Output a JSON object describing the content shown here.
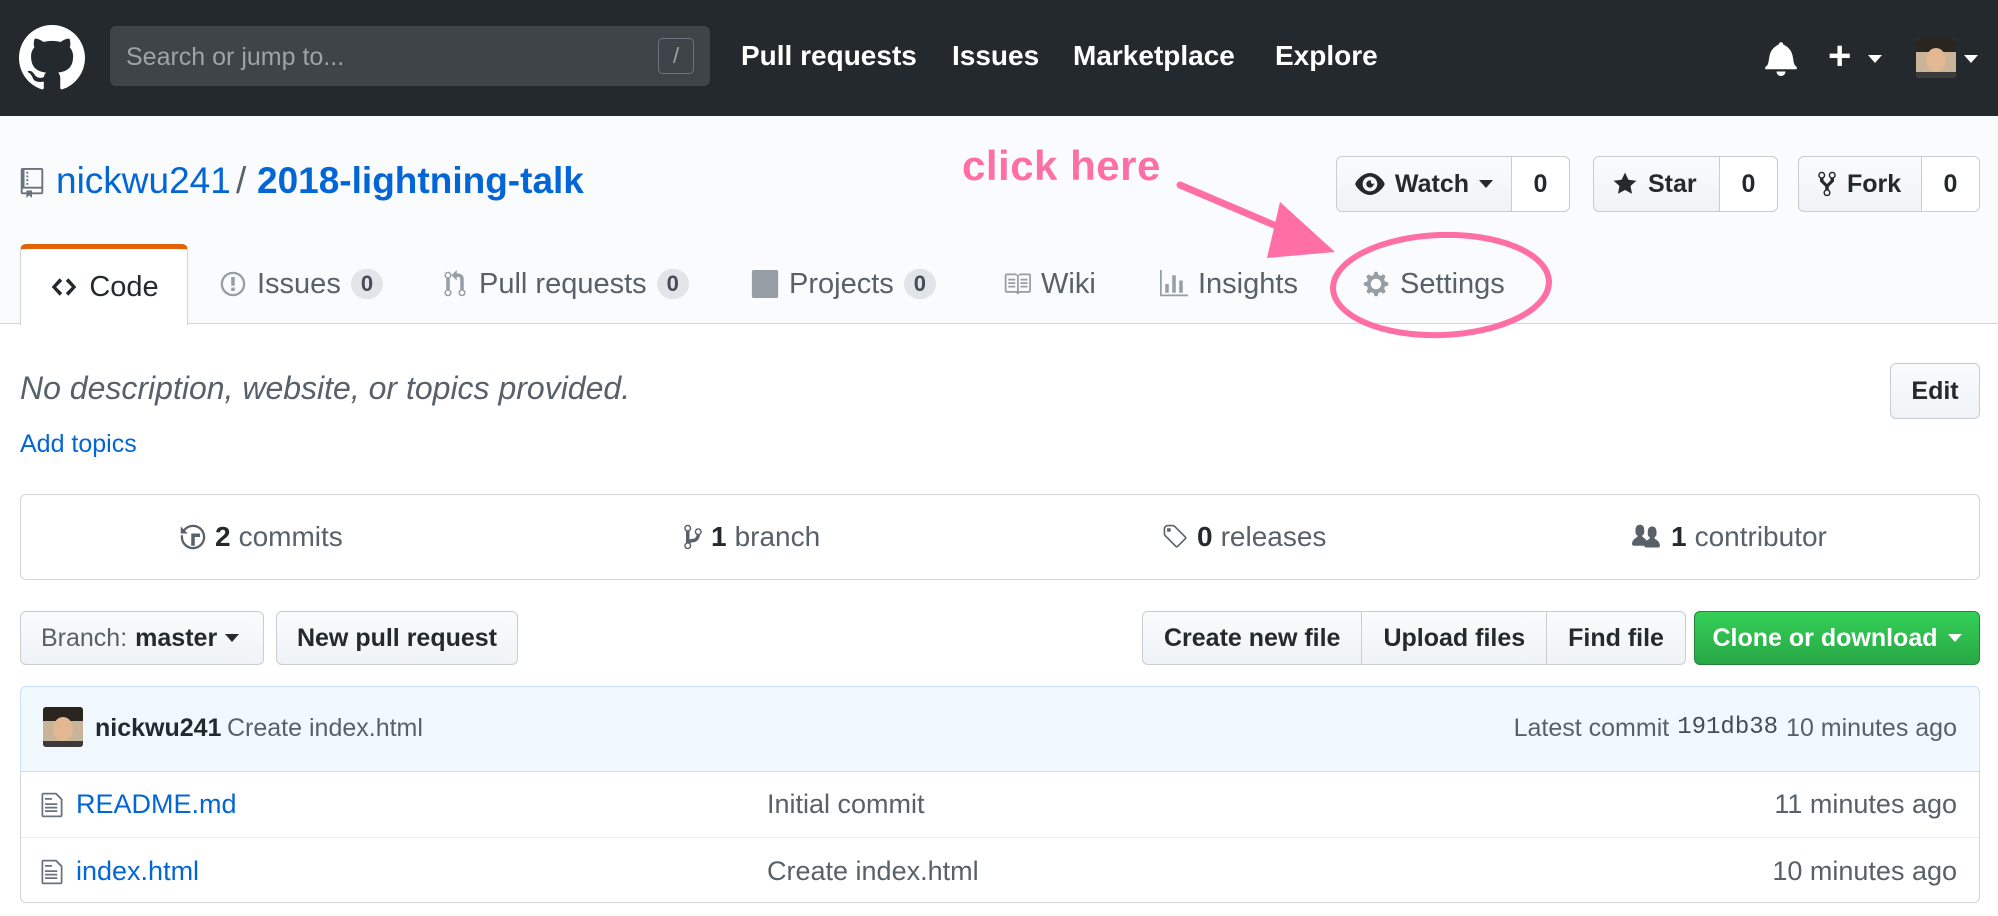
{
  "header": {
    "search_placeholder": "Search or jump to...",
    "search_key": "/",
    "nav": [
      "Pull requests",
      "Issues",
      "Marketplace",
      "Explore"
    ],
    "plus": "+"
  },
  "repo": {
    "owner": "nickwu241",
    "separator": "/",
    "name": "2018-lightning-talk",
    "watch_label": "Watch",
    "watch_count": "0",
    "star_label": "Star",
    "star_count": "0",
    "fork_label": "Fork",
    "fork_count": "0"
  },
  "tabs": [
    {
      "label": "Code",
      "icon": "code-icon"
    },
    {
      "label": "Issues",
      "count": "0",
      "icon": "issue-icon"
    },
    {
      "label": "Pull requests",
      "count": "0",
      "icon": "pull-request-icon"
    },
    {
      "label": "Projects",
      "count": "0",
      "icon": "project-icon"
    },
    {
      "label": "Wiki",
      "icon": "book-icon"
    },
    {
      "label": "Insights",
      "icon": "graph-icon"
    },
    {
      "label": "Settings",
      "icon": "gear-icon"
    }
  ],
  "annotation": {
    "text": "click here",
    "color": "#ff6fa6"
  },
  "description": {
    "text": "No description, website, or topics provided.",
    "add_topics": "Add topics",
    "edit": "Edit"
  },
  "summary": {
    "commits_count": "2",
    "commits_label": "commits",
    "branch_count": "1",
    "branch_label": "branch",
    "releases_count": "0",
    "releases_label": "releases",
    "contributor_count": "1",
    "contributor_label": "contributor"
  },
  "filenav": {
    "branch_prefix": "Branch:",
    "branch_name": "master",
    "new_pr": "New pull request",
    "create_file": "Create new file",
    "upload_files": "Upload files",
    "find_file": "Find file",
    "clone": "Clone or download"
  },
  "latest_commit": {
    "author": "nickwu241",
    "message": "Create index.html",
    "prefix": "Latest commit",
    "sha": "191db38",
    "age": "10 minutes ago"
  },
  "files": [
    {
      "name": "README.md",
      "message": "Initial commit",
      "age": "11 minutes ago"
    },
    {
      "name": "index.html",
      "message": "Create index.html",
      "age": "10 minutes ago"
    }
  ],
  "colors": {
    "header_bg": "#24292e",
    "link": "#0366d6",
    "tab_accent": "#e36209",
    "clone_green": "#28a745",
    "annotation": "#ff6fa6"
  }
}
